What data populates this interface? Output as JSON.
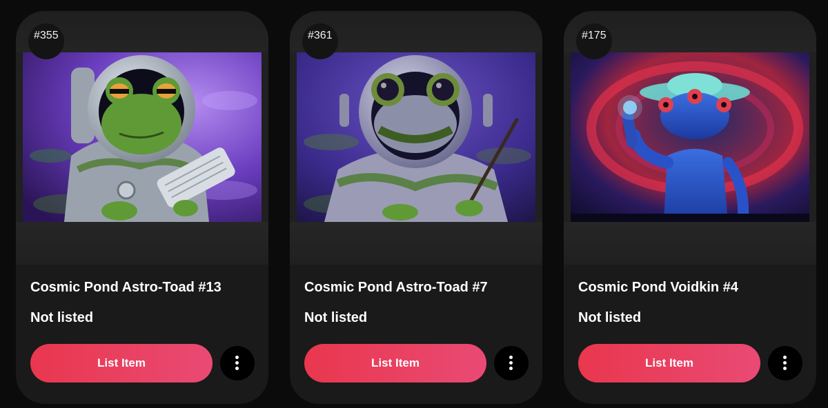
{
  "cards": [
    {
      "rank": "#355",
      "title": "Cosmic Pond Astro-Toad #13",
      "status": "Not listed",
      "list_label": "List Item",
      "image_alt": "astro-toad-13-artwork"
    },
    {
      "rank": "#361",
      "title": "Cosmic Pond Astro-Toad #7",
      "status": "Not listed",
      "list_label": "List Item",
      "image_alt": "astro-toad-7-artwork"
    },
    {
      "rank": "#175",
      "title": "Cosmic Pond Voidkin #4",
      "status": "Not listed",
      "list_label": "List Item",
      "image_alt": "voidkin-4-artwork"
    }
  ],
  "icons": {
    "more": "more-vertical-icon"
  },
  "colors": {
    "page_bg": "#0b0b0b",
    "card_bg": "#1a1a1a",
    "button_start": "#e9374e",
    "button_end": "#e94a74",
    "more_button_bg": "#000000"
  }
}
